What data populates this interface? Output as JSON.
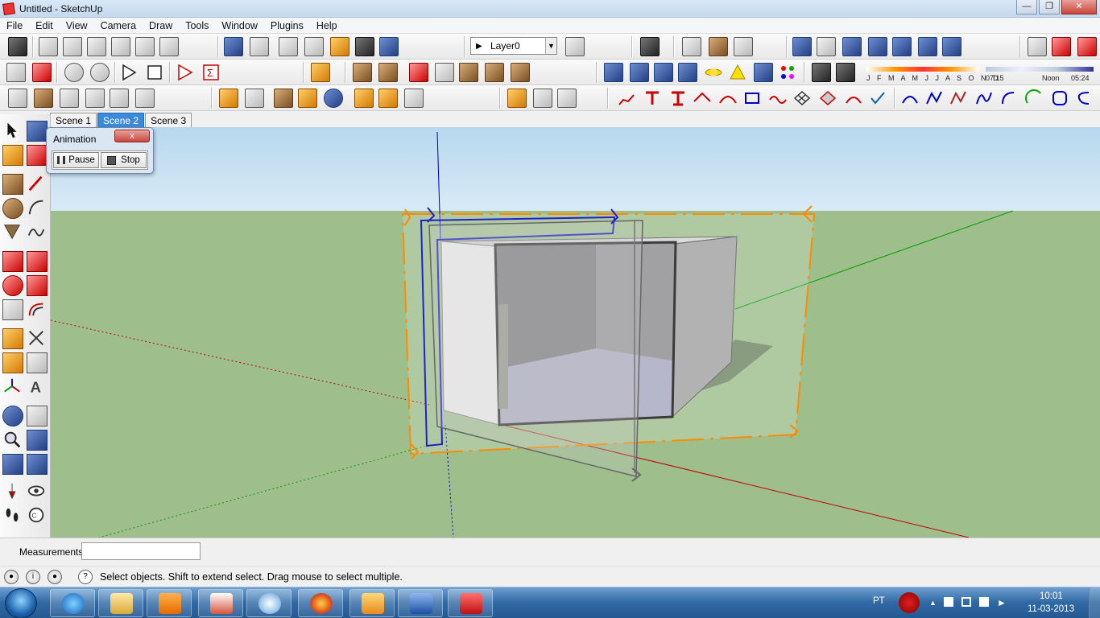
{
  "window": {
    "title": "Untitled - SketchUp"
  },
  "menu": [
    "File",
    "Edit",
    "View",
    "Camera",
    "Draw",
    "Tools",
    "Window",
    "Plugins",
    "Help"
  ],
  "layer": {
    "value": "Layer0"
  },
  "shadow": {
    "months": "J F M A M J J A S O N D",
    "time_left": "07:15",
    "time_mid": "Noon",
    "time_right": "05:24"
  },
  "scenes": [
    {
      "label": "Scene 1",
      "active": false
    },
    {
      "label": "Scene 2",
      "active": true
    },
    {
      "label": "Scene 3",
      "active": false
    }
  ],
  "animation": {
    "title": "Animation",
    "pause_label": "Pause",
    "stop_label": "Stop",
    "close_label": "x"
  },
  "measurements": {
    "label": "Measurements",
    "value": ""
  },
  "status": {
    "text": "Select objects. Shift to extend select. Drag mouse to select multiple."
  },
  "taskbar": {
    "language": "PT",
    "time": "10:01",
    "date": "11-03-2013"
  },
  "colors": {
    "axis_red": "#c00000",
    "axis_green": "#00a000",
    "axis_blue": "#0000c0",
    "selection_orange": "#ff8a00",
    "scene_tab_active": "#3a8bdc"
  }
}
